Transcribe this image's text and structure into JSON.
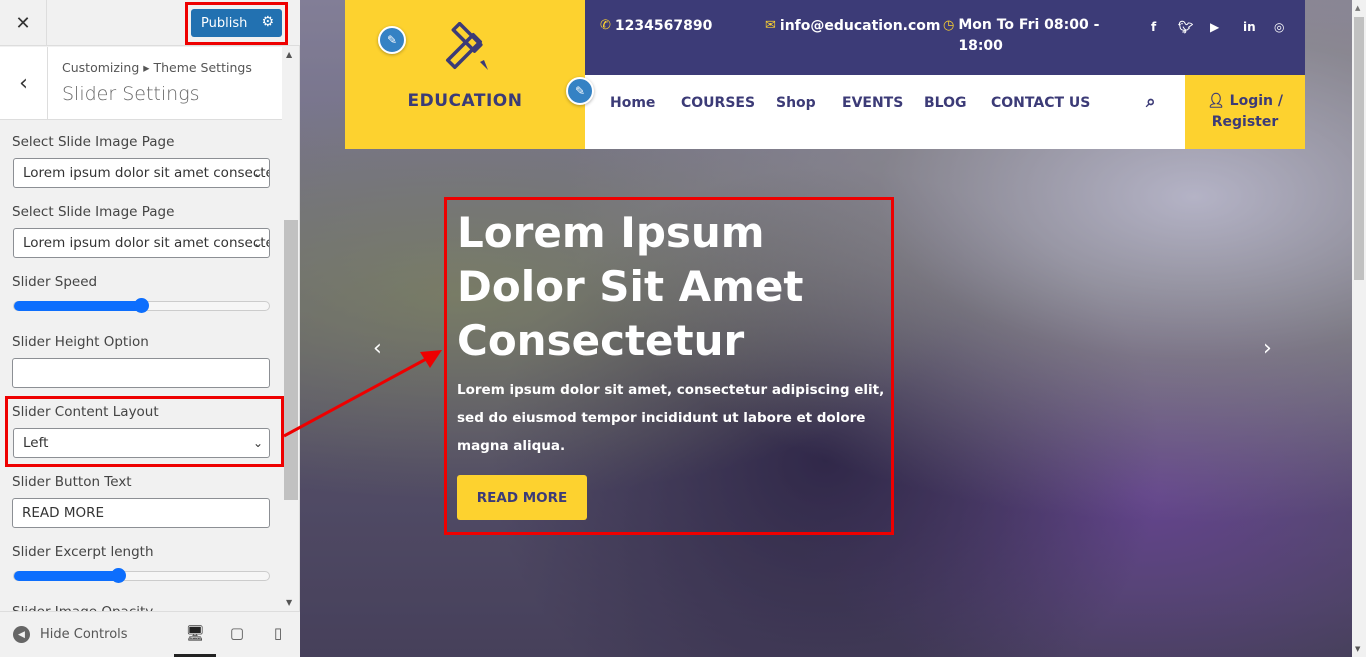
{
  "sidebar": {
    "close_label": "✕",
    "publish_label": "Publish",
    "breadcrumb": "Customizing ▸ Theme Settings",
    "section_title": "Slider Settings",
    "controls": {
      "slide_page_1": {
        "label": "Select Slide Image Page",
        "value": "Lorem ipsum dolor sit amet consectetur"
      },
      "slide_page_2": {
        "label": "Select Slide Image Page",
        "value": "Lorem ipsum dolor sit amet consectetur"
      },
      "slider_speed": {
        "label": "Slider Speed",
        "value_fraction": 0.5
      },
      "slider_height": {
        "label": "Slider Height Option",
        "value": ""
      },
      "content_layout": {
        "label": "Slider Content Layout",
        "value": "Left"
      },
      "button_text": {
        "label": "Slider Button Text",
        "value": "READ MORE"
      },
      "excerpt_length": {
        "label": "Slider Excerpt length",
        "value_fraction": 0.41
      },
      "image_opacity": {
        "label": "Slider Image Opacity"
      }
    },
    "footer": {
      "hide_controls": "Hide Controls",
      "devices": [
        "desktop",
        "tablet",
        "mobile"
      ]
    }
  },
  "preview": {
    "logo_text": "EDUCATION",
    "topbar": {
      "phone": "1234567890",
      "email": "info@education.com",
      "hours_line1": "Mon To Fri 08:00 -",
      "hours_line2": "18:00"
    },
    "social": [
      "facebook",
      "twitter",
      "youtube",
      "linkedin",
      "instagram"
    ],
    "nav": [
      "Home",
      "COURSES",
      "Shop",
      "EVENTS",
      "BLOG",
      "CONTACT US"
    ],
    "login_line1": "Login /",
    "login_line2": "Register",
    "slide": {
      "title": "Lorem Ipsum Dolor Sit Amet Consectetur",
      "text": "Lorem ipsum dolor sit amet, consectetur adipiscing elit, sed do eiusmod tempor incididunt ut labore et dolore magna aliqua.",
      "button": "READ MORE"
    }
  },
  "colors": {
    "accent_yellow": "#fdd22f",
    "navy": "#3c3b77",
    "publish_blue": "#2271b1",
    "annotation_red": "#ee0000"
  }
}
